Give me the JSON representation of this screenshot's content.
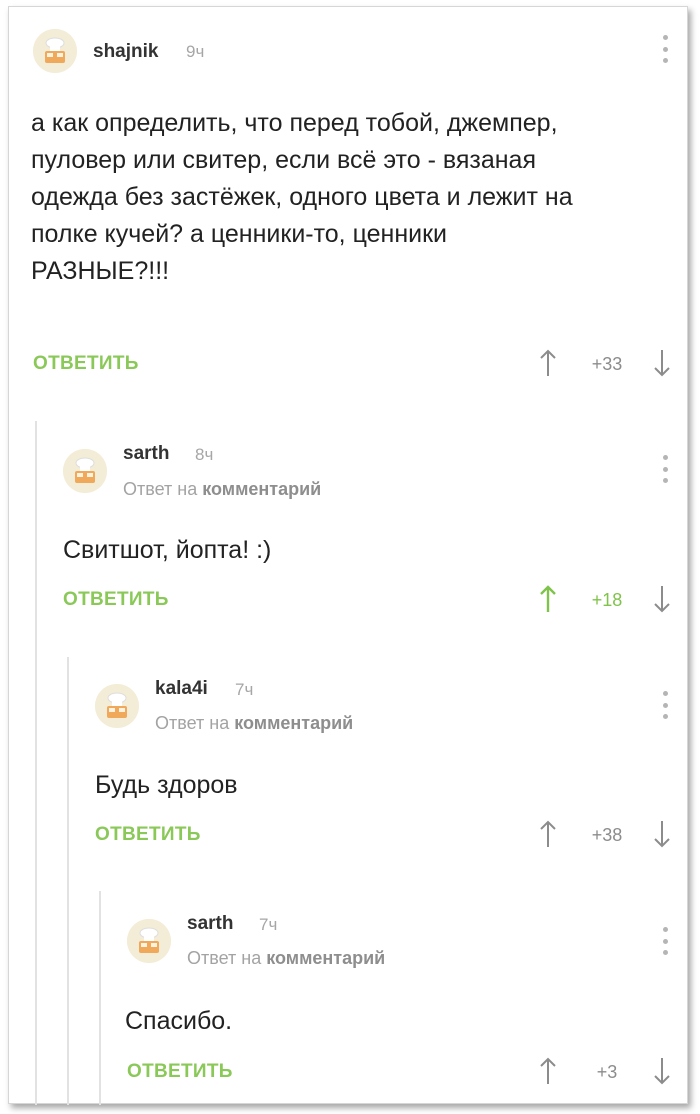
{
  "comments": [
    {
      "username": "shajnik",
      "time": "9ч",
      "reply_prefix": "",
      "reply_target": "",
      "text": "а как определить, что перед тобой, джемпер, пуловер или свитер, если всё это - вязаная одежда без застёжек, одного цвета и лежит на полке кучей? а ценники-то, ценники РАЗНЫЕ?!!!",
      "reply_label": "ОТВЕТИТЬ",
      "rating": "+33",
      "upvoted": false
    },
    {
      "username": "sarth",
      "time": "8ч",
      "reply_prefix": "Ответ на ",
      "reply_target": "комментарий",
      "text": "Свитшот, йопта! :)",
      "reply_label": "ОТВЕТИТЬ",
      "rating": "+18",
      "upvoted": true
    },
    {
      "username": "kala4i",
      "time": "7ч",
      "reply_prefix": "Ответ на ",
      "reply_target": "комментарий",
      "text": "Будь здоров",
      "reply_label": "ОТВЕТИТЬ",
      "rating": "+38",
      "upvoted": false
    },
    {
      "username": "sarth",
      "time": "7ч",
      "reply_prefix": "Ответ на ",
      "reply_target": "комментарий",
      "text": "Спасибо.",
      "reply_label": "ОТВЕТИТЬ",
      "rating": "+3",
      "upvoted": false
    }
  ],
  "colors": {
    "accent_green": "#8ac858",
    "upvote_active": "#7fc34a",
    "thread_line": "#e2e2e2",
    "muted_text": "#a6a6a6"
  },
  "icons": {
    "avatar": "default-avatar-icon",
    "menu": "more-vertical-icon",
    "upvote": "arrow-up-icon",
    "downvote": "arrow-down-icon"
  }
}
